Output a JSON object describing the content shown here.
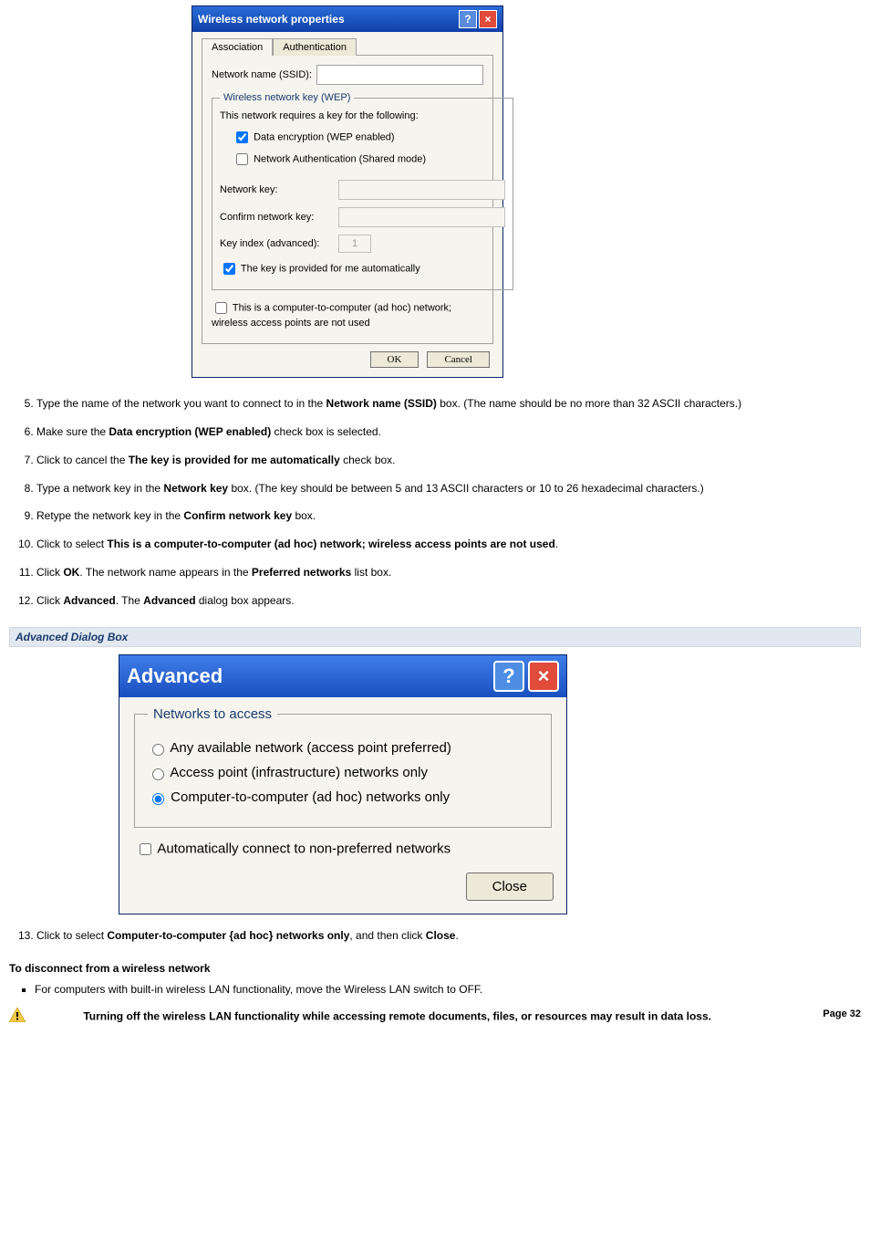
{
  "dialog1": {
    "title": "Wireless network properties",
    "tab_assoc": "Association",
    "tab_auth": "Authentication",
    "ssid_label": "Network name (SSID):",
    "wep_legend": "Wireless network key (WEP)",
    "requires_text": "This network requires a key for the following:",
    "cb_data_enc": "Data encryption (WEP enabled)",
    "cb_net_auth": "Network Authentication (Shared mode)",
    "net_key_label": "Network key:",
    "confirm_key_label": "Confirm network key:",
    "key_index_label": "Key index (advanced):",
    "key_index_val": "1",
    "cb_auto_key": "The key is provided for me automatically",
    "cb_adhoc": "This is a computer-to-computer (ad hoc) network; wireless access points are not used",
    "btn_ok": "OK",
    "btn_cancel": "Cancel"
  },
  "steps1": {
    "s5a": "Type the name of the network you want to connect to in the ",
    "s5b": "Network name (SSID)",
    "s5c": " box. (The name should be no more than 32 ASCII characters.)",
    "s6a": "Make sure the ",
    "s6b": "Data encryption (WEP enabled)",
    "s6c": " check box is selected.",
    "s7a": "Click to cancel the ",
    "s7b": "The key is provided for me automatically",
    "s7c": " check box.",
    "s8a": "Type a network key in the ",
    "s8b": "Network key",
    "s8c": " box. (The key should be between 5 and 13 ASCII characters or 10 to 26 hexadecimal characters.)",
    "s9a": "Retype the network key in the ",
    "s9b": "Confirm network key",
    "s9c": " box.",
    "s10a": "Click to select ",
    "s10b": "This is a computer-to-computer (ad hoc) network; wireless access points are not used",
    "s10c": ".",
    "s11a": "Click ",
    "s11b": "OK",
    "s11c": ". The network name appears in the ",
    "s11d": "Preferred networks",
    "s11e": " list box.",
    "s12a": "Click ",
    "s12b": "Advanced",
    "s12c": ". The ",
    "s12d": "Advanced",
    "s12e": " dialog box appears."
  },
  "adv_heading": "Advanced Dialog Box",
  "dialog2": {
    "title": "Advanced",
    "legend": "Networks to access",
    "r1": "Any available network (access point preferred)",
    "r2": "Access point (infrastructure) networks only",
    "r3": "Computer-to-computer (ad hoc) networks only",
    "cb_auto": "Automatically connect to non-preferred networks",
    "btn_close": "Close"
  },
  "step13a": "Click to select ",
  "step13b": "Computer-to-computer {ad hoc} networks only",
  "step13c": ", and then click ",
  "step13d": "Close",
  "step13e": ".",
  "disconnect_heading": "To disconnect from a wireless network",
  "disconnect_li": "For computers with built-in wireless LAN functionality, move the Wireless LAN switch to OFF.",
  "warning_text": "Turning off the wireless LAN functionality while accessing remote documents, files, or resources may result in data loss.",
  "page_num": "Page 32"
}
